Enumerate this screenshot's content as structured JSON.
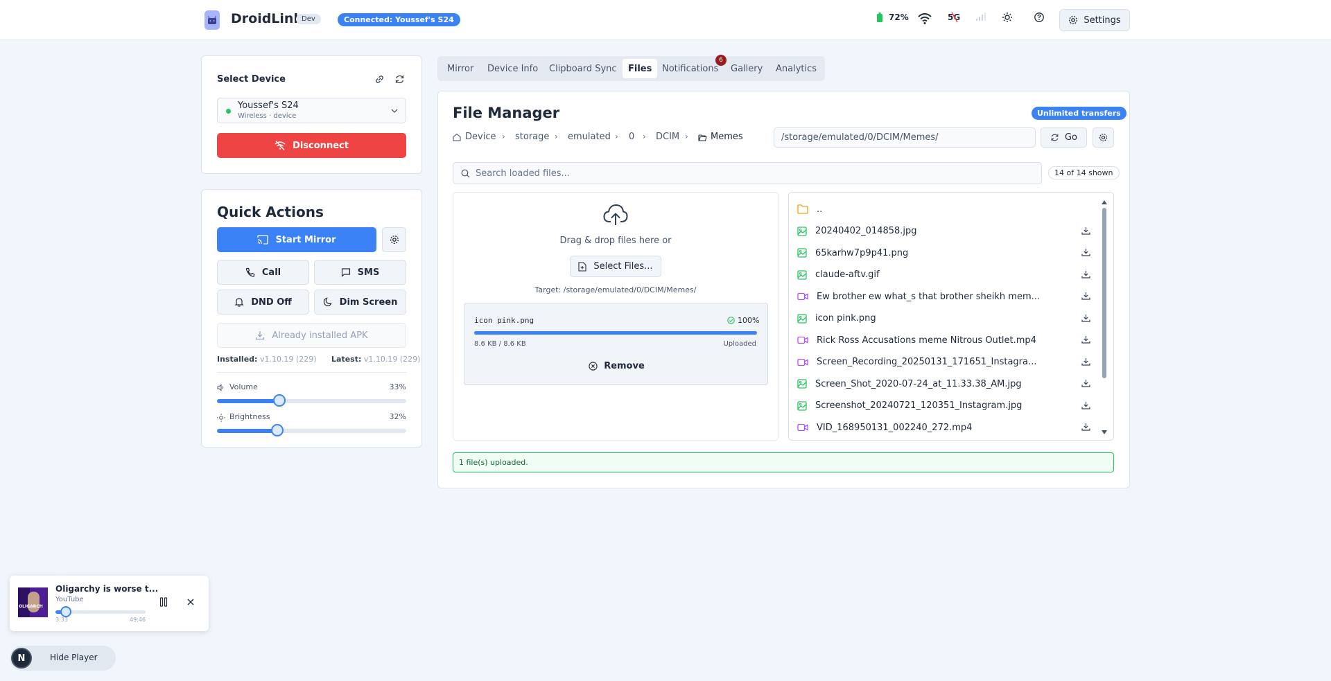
{
  "header": {
    "brand": "DroidLink",
    "dev_badge": "Dev",
    "connection": "Connected: Youssef's S24",
    "battery": "72%",
    "network": "5G",
    "settings_label": "Settings"
  },
  "device_panel": {
    "title": "Select Device",
    "device_name": "Youssef's S24",
    "device_sub": "Wireless · device",
    "disconnect_label": "Disconnect"
  },
  "quick_actions": {
    "title": "Quick Actions",
    "start_mirror": "Start Mirror",
    "call": "Call",
    "sms": "SMS",
    "dnd": "DND Off",
    "dim": "Dim Screen",
    "apk": "Already installed APK",
    "installed_label": "Installed:",
    "installed_version": "v1.10.19 (229)",
    "latest_label": "Latest:",
    "latest_version": "v1.10.19 (229)",
    "volume_label": "Volume",
    "volume_value": "33%",
    "volume_fraction": 0.33,
    "brightness_label": "Brightness",
    "brightness_value": "32%",
    "brightness_fraction": 0.32
  },
  "tabs": [
    {
      "label": "Mirror"
    },
    {
      "label": "Device Info"
    },
    {
      "label": "Clipboard Sync"
    },
    {
      "label": "Files"
    },
    {
      "label": "Notifications",
      "badge": "6"
    },
    {
      "label": "Gallery"
    },
    {
      "label": "Analytics"
    }
  ],
  "file_manager": {
    "title": "File Manager",
    "badge": "Unlimited transfers",
    "breadcrumb": [
      "Device",
      "storage",
      "emulated",
      "0",
      "DCIM",
      "Memes"
    ],
    "path_value": "/storage/emulated/0/DCIM/Memes/",
    "go_label": "Go",
    "search_placeholder": "Search loaded files...",
    "shown_count": "14 of 14 shown",
    "drop_text": "Drag & drop files here or",
    "select_files": "Select Files...",
    "target": "Target: /storage/emulated/0/DCIM/Memes/",
    "upload": {
      "name": "icon pink.png",
      "percent": "100%",
      "progress": 1.0,
      "size": "8.6 KB / 8.6 KB",
      "state": "Uploaded",
      "remove": "Remove"
    },
    "files": [
      {
        "name": "..",
        "kind": "folder"
      },
      {
        "name": "20240402_014858.jpg",
        "kind": "image"
      },
      {
        "name": "65karhw7p9p41.png",
        "kind": "image"
      },
      {
        "name": "claude-aftv.gif",
        "kind": "image"
      },
      {
        "name": "Ew brother ew what_s that brother sheikh mem...",
        "kind": "video"
      },
      {
        "name": "icon pink.png",
        "kind": "image"
      },
      {
        "name": "Rick Ross Accusations meme Nitrous Outlet.mp4",
        "kind": "video"
      },
      {
        "name": "Screen_Recording_20250131_171651_Instagra...",
        "kind": "video"
      },
      {
        "name": "Screen_Shot_2020-07-24_at_11.33.38_AM.jpg",
        "kind": "image"
      },
      {
        "name": "Screenshot_20240721_120351_Instagram.jpg",
        "kind": "image"
      },
      {
        "name": "VID_168950131_002240_272.mp4",
        "kind": "video"
      }
    ],
    "status": "1 file(s) uploaded."
  },
  "player": {
    "title": "Oligarchy is worse t...",
    "source": "YouTube",
    "elapsed": "3:33",
    "duration": "49:46",
    "progress": 0.12,
    "thumb_text": "OLIGARCH",
    "hide_label": "Hide Player",
    "avatar_letter": "N"
  },
  "colors": {
    "accent": "#3b82f6",
    "danger": "#ef4444",
    "image_icon": "#22c55e",
    "video_icon": "#a855f7",
    "folder_icon": "#f59e0b"
  }
}
